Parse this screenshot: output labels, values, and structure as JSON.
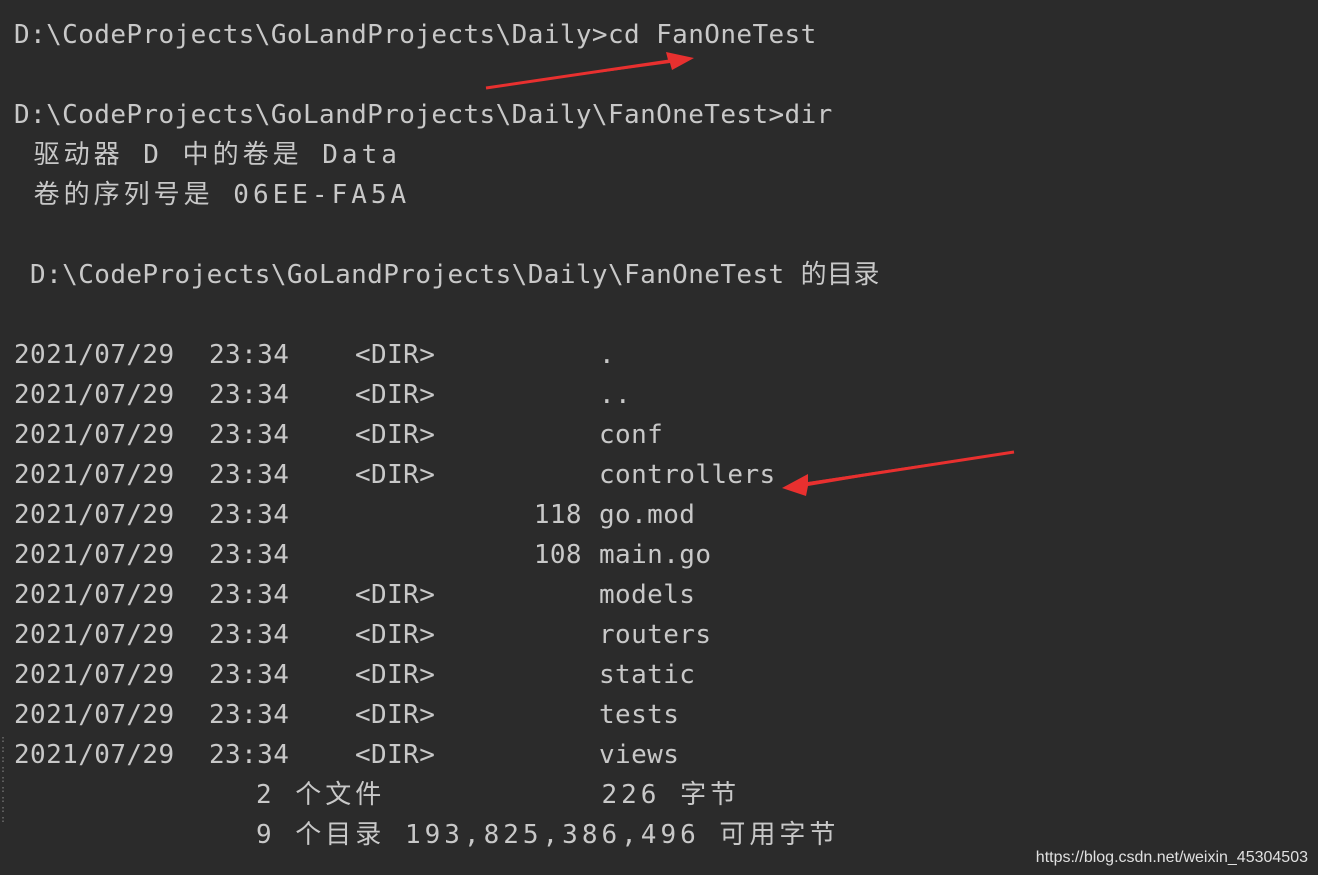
{
  "terminal": {
    "cmd1": "D:\\CodeProjects\\GoLandProjects\\Daily>cd FanOneTest",
    "cmd2": "D:\\CodeProjects\\GoLandProjects\\Daily\\FanOneTest>dir",
    "volume_line": " 驱动器 D 中的卷是 Data",
    "serial_line": " 卷的序列号是 06EE-FA5A",
    "dir_of_line": " D:\\CodeProjects\\GoLandProjects\\Daily\\FanOneTest 的目录",
    "entries": [
      {
        "date": "2021/07/29",
        "time": "23:34",
        "type": "<DIR>",
        "size": "",
        "name": "."
      },
      {
        "date": "2021/07/29",
        "time": "23:34",
        "type": "<DIR>",
        "size": "",
        "name": ".."
      },
      {
        "date": "2021/07/29",
        "time": "23:34",
        "type": "<DIR>",
        "size": "",
        "name": "conf"
      },
      {
        "date": "2021/07/29",
        "time": "23:34",
        "type": "<DIR>",
        "size": "",
        "name": "controllers"
      },
      {
        "date": "2021/07/29",
        "time": "23:34",
        "type": "",
        "size": "118",
        "name": "go.mod"
      },
      {
        "date": "2021/07/29",
        "time": "23:34",
        "type": "",
        "size": "108",
        "name": "main.go"
      },
      {
        "date": "2021/07/29",
        "time": "23:34",
        "type": "<DIR>",
        "size": "",
        "name": "models"
      },
      {
        "date": "2021/07/29",
        "time": "23:34",
        "type": "<DIR>",
        "size": "",
        "name": "routers"
      },
      {
        "date": "2021/07/29",
        "time": "23:34",
        "type": "<DIR>",
        "size": "",
        "name": "static"
      },
      {
        "date": "2021/07/29",
        "time": "23:34",
        "type": "<DIR>",
        "size": "",
        "name": "tests"
      },
      {
        "date": "2021/07/29",
        "time": "23:34",
        "type": "<DIR>",
        "size": "",
        "name": "views"
      }
    ],
    "summary_files": "2 个文件           226 字节",
    "summary_dirs": "9 个目录 193,825,386,496 可用字节"
  },
  "watermark": "https://blog.csdn.net/weixin_45304503",
  "colors": {
    "background": "#2b2b2b",
    "text": "#c8c8c8",
    "arrow": "#e8302f"
  }
}
